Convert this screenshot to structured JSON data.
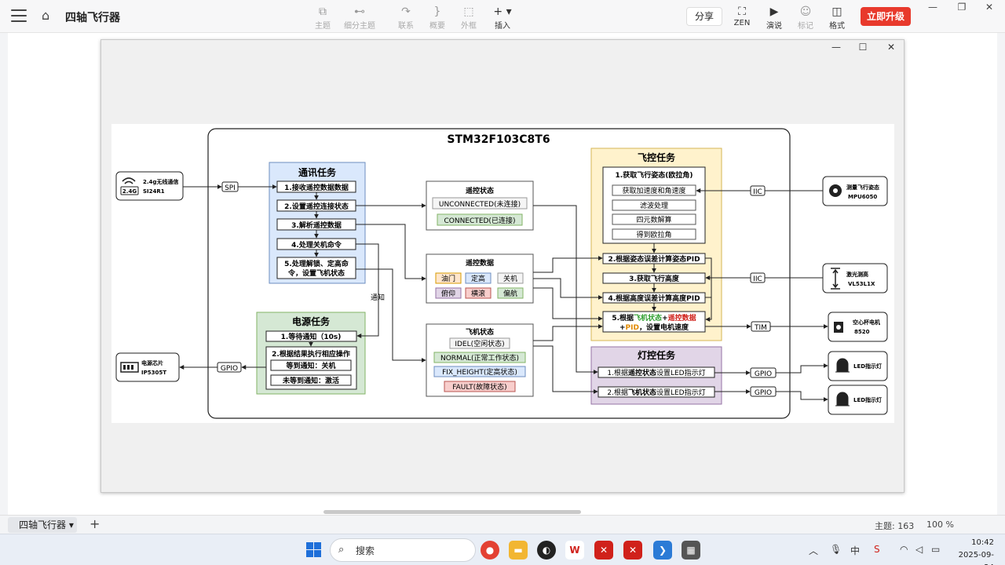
{
  "app": {
    "doc_title": "四轴飞行器",
    "toolbar": {
      "topic": "主题",
      "subtopic": "细分主题",
      "relation": "联系",
      "summary": "概要",
      "boundary": "外框",
      "insert": "插入",
      "share": "分享",
      "zen": "ZEN",
      "present": "演说",
      "mark": "标记",
      "format": "格式",
      "upgrade": "立即升级"
    }
  },
  "diagram": {
    "title": "STM32F103C8T6",
    "comm_task": {
      "title": "通讯任务",
      "steps": [
        "1.接收遥控数据数据",
        "2.设置遥控连接状态",
        "3.解析遥控数据",
        "4.处理关机命令",
        "5.处理解锁、定高命",
        "令，设置飞机状态"
      ]
    },
    "remote_state": {
      "title": "遥控状态",
      "items": [
        "UNCONNECTED(未连接)",
        "CONNECTED(已连接)"
      ]
    },
    "remote_data": {
      "title": "遥控数据",
      "items": [
        "油门",
        "定高",
        "关机",
        "俯仰",
        "横滚",
        "偏航"
      ]
    },
    "plane_state": {
      "title": "飞机状态",
      "items": [
        "IDEL(空闲状态)",
        "NORMAL(正常工作状态)",
        "FIX_HEIGHT(定高状态)",
        "FAULT(故障状态)"
      ]
    },
    "flight_task": {
      "title": "飞控任务",
      "step1": "1.获取飞行姿态(欧拉角)",
      "sub": [
        "获取加速度和角速度",
        "滤波处理",
        "四元数解算",
        "得到欧拉角"
      ],
      "step2": "2.根据姿态误差计算姿态PID",
      "step3": "3.获取飞行高度",
      "step4": "4.根据高度误差计算高度PID",
      "step5_a": "5.根据",
      "step5_b": "飞机状态",
      "step5_c": "+",
      "step5_d": "遥控数据",
      "step5_e": "+",
      "step5_f": "PID",
      "step5_g": "，设置电机速度"
    },
    "power_task": {
      "title": "电源任务",
      "step1": "1.等待通知（10s)",
      "step2": "2.根据结果执行相应操作",
      "sub": [
        "等到通知：关机",
        "未等到通知：激活"
      ]
    },
    "light_task": {
      "title": "灯控任务",
      "step1_a": "1.根据",
      "step1_b": "遥控状态",
      "step1_c": "设置LED指示灯",
      "step2_a": "2.根据",
      "step2_b": "飞机状态",
      "step2_c": "设置LED指示灯"
    },
    "notify_label": "通知",
    "buses": {
      "spi": "SPI",
      "iic1": "IIC",
      "iic2": "IIC",
      "tim": "TIM",
      "gpio_power": "GPIO",
      "gpio_led1": "GPIO",
      "gpio_led2": "GPIO"
    },
    "devices": {
      "radio_line1": "2.4g无线通信",
      "radio_line2": "SI24R1",
      "radio_badge": "2.4G",
      "power_line1": "电源芯片",
      "power_line2": "IP5305T",
      "imu_line1": "测量飞行姿态",
      "imu_line2": "MPU6050",
      "laser_line1": "激光测高",
      "laser_line2": "VL53L1X",
      "motor_line1": "空心杯电机",
      "motor_line2": "8520",
      "led1": "LED指示灯",
      "led2": "LED指示灯"
    }
  },
  "statusbar": {
    "sheet_tab": "四轴飞行器",
    "topic_count": "主题: 163",
    "zoom": "100 %"
  },
  "taskbar": {
    "search": "搜索",
    "time": "10:42",
    "date": "2025-09-24"
  }
}
